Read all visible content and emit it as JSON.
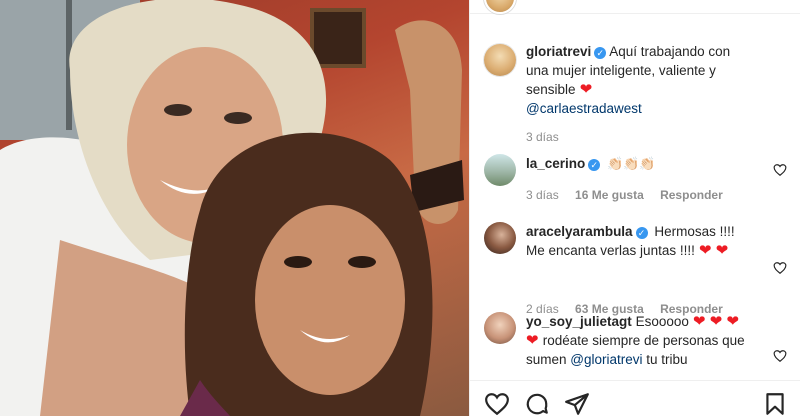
{
  "post": {
    "author": "gloriatrevi",
    "caption": "Aquí trabajando con una mujer inteligente, valiente y sensible",
    "caption_mention": "@carlaestradawest",
    "time": "3 días"
  },
  "comments": [
    {
      "user": "la_cerino",
      "text": "👏🏻👏🏻👏🏻",
      "time": "3 días",
      "likes": "16 Me gusta",
      "reply": "Responder"
    },
    {
      "user": "aracelyarambula",
      "text": "Hermosas !!!! Me encanta verlas juntas !!!!",
      "time": "2 días",
      "likes": "63 Me gusta",
      "reply": "Responder"
    },
    {
      "user": "yo_soy_julietagt",
      "text_a": "Esooooo",
      "text_b": "rodéate siempre de personas que sumen",
      "mention": "@gloriatrevi",
      "text_c": "tu tribu"
    }
  ],
  "icons": {
    "verified": "verified-badge-icon",
    "heart": "heart-icon",
    "comment": "comment-icon",
    "share": "paper-plane-icon",
    "save": "bookmark-icon"
  },
  "colors": {
    "accent": "#3897f0",
    "heart": "#ed1c24",
    "mention": "#00376b",
    "muted": "#8e8e8e"
  }
}
